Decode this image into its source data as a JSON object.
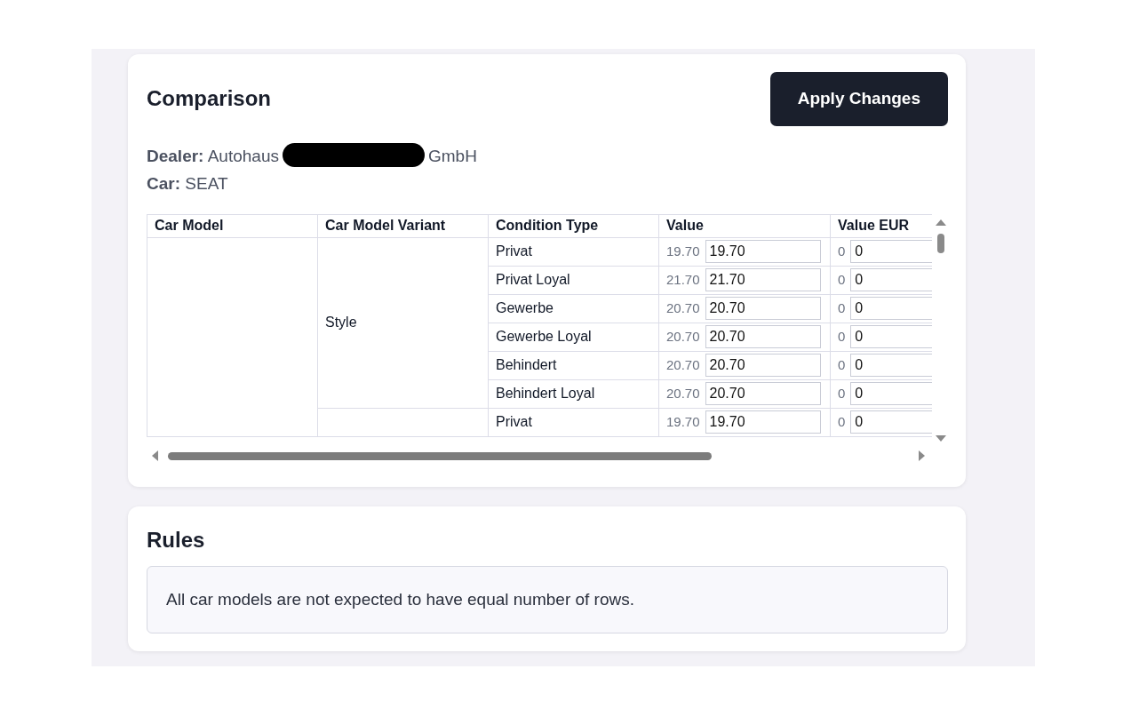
{
  "comparison": {
    "title": "Comparison",
    "apply_button": "Apply Changes",
    "dealer": {
      "label": "Dealer:",
      "name_before": "Autohaus",
      "name_after": "GmbH"
    },
    "car": {
      "label": "Car:",
      "value": "SEAT"
    },
    "table": {
      "columns": [
        "Car Model",
        "Car Model Variant",
        "Condition Type",
        "Value",
        "Value EUR"
      ],
      "models": [
        {
          "variants": [
            {
              "name": "Style",
              "conditions": [
                {
                  "type": "Privat",
                  "value_ref": "19.70",
                  "value": "19.70",
                  "eur_ref": "0",
                  "eur": "0"
                },
                {
                  "type": "Privat Loyal",
                  "value_ref": "21.70",
                  "value": "21.70",
                  "eur_ref": "0",
                  "eur": "0"
                },
                {
                  "type": "Gewerbe",
                  "value_ref": "20.70",
                  "value": "20.70",
                  "eur_ref": "0",
                  "eur": "0"
                },
                {
                  "type": "Gewerbe Loyal",
                  "value_ref": "20.70",
                  "value": "20.70",
                  "eur_ref": "0",
                  "eur": "0"
                },
                {
                  "type": "Behindert",
                  "value_ref": "20.70",
                  "value": "20.70",
                  "eur_ref": "0",
                  "eur": "0"
                },
                {
                  "type": "Behindert Loyal",
                  "value_ref": "20.70",
                  "value": "20.70",
                  "eur_ref": "0",
                  "eur": "0"
                }
              ]
            },
            {
              "conditions": [
                {
                  "type": "Privat",
                  "value_ref": "19.70",
                  "value": "19.70",
                  "eur_ref": "0",
                  "eur": "0"
                }
              ]
            }
          ]
        }
      ]
    }
  },
  "rules": {
    "title": "Rules",
    "message": "All car models are not expected to have equal number of rows."
  }
}
